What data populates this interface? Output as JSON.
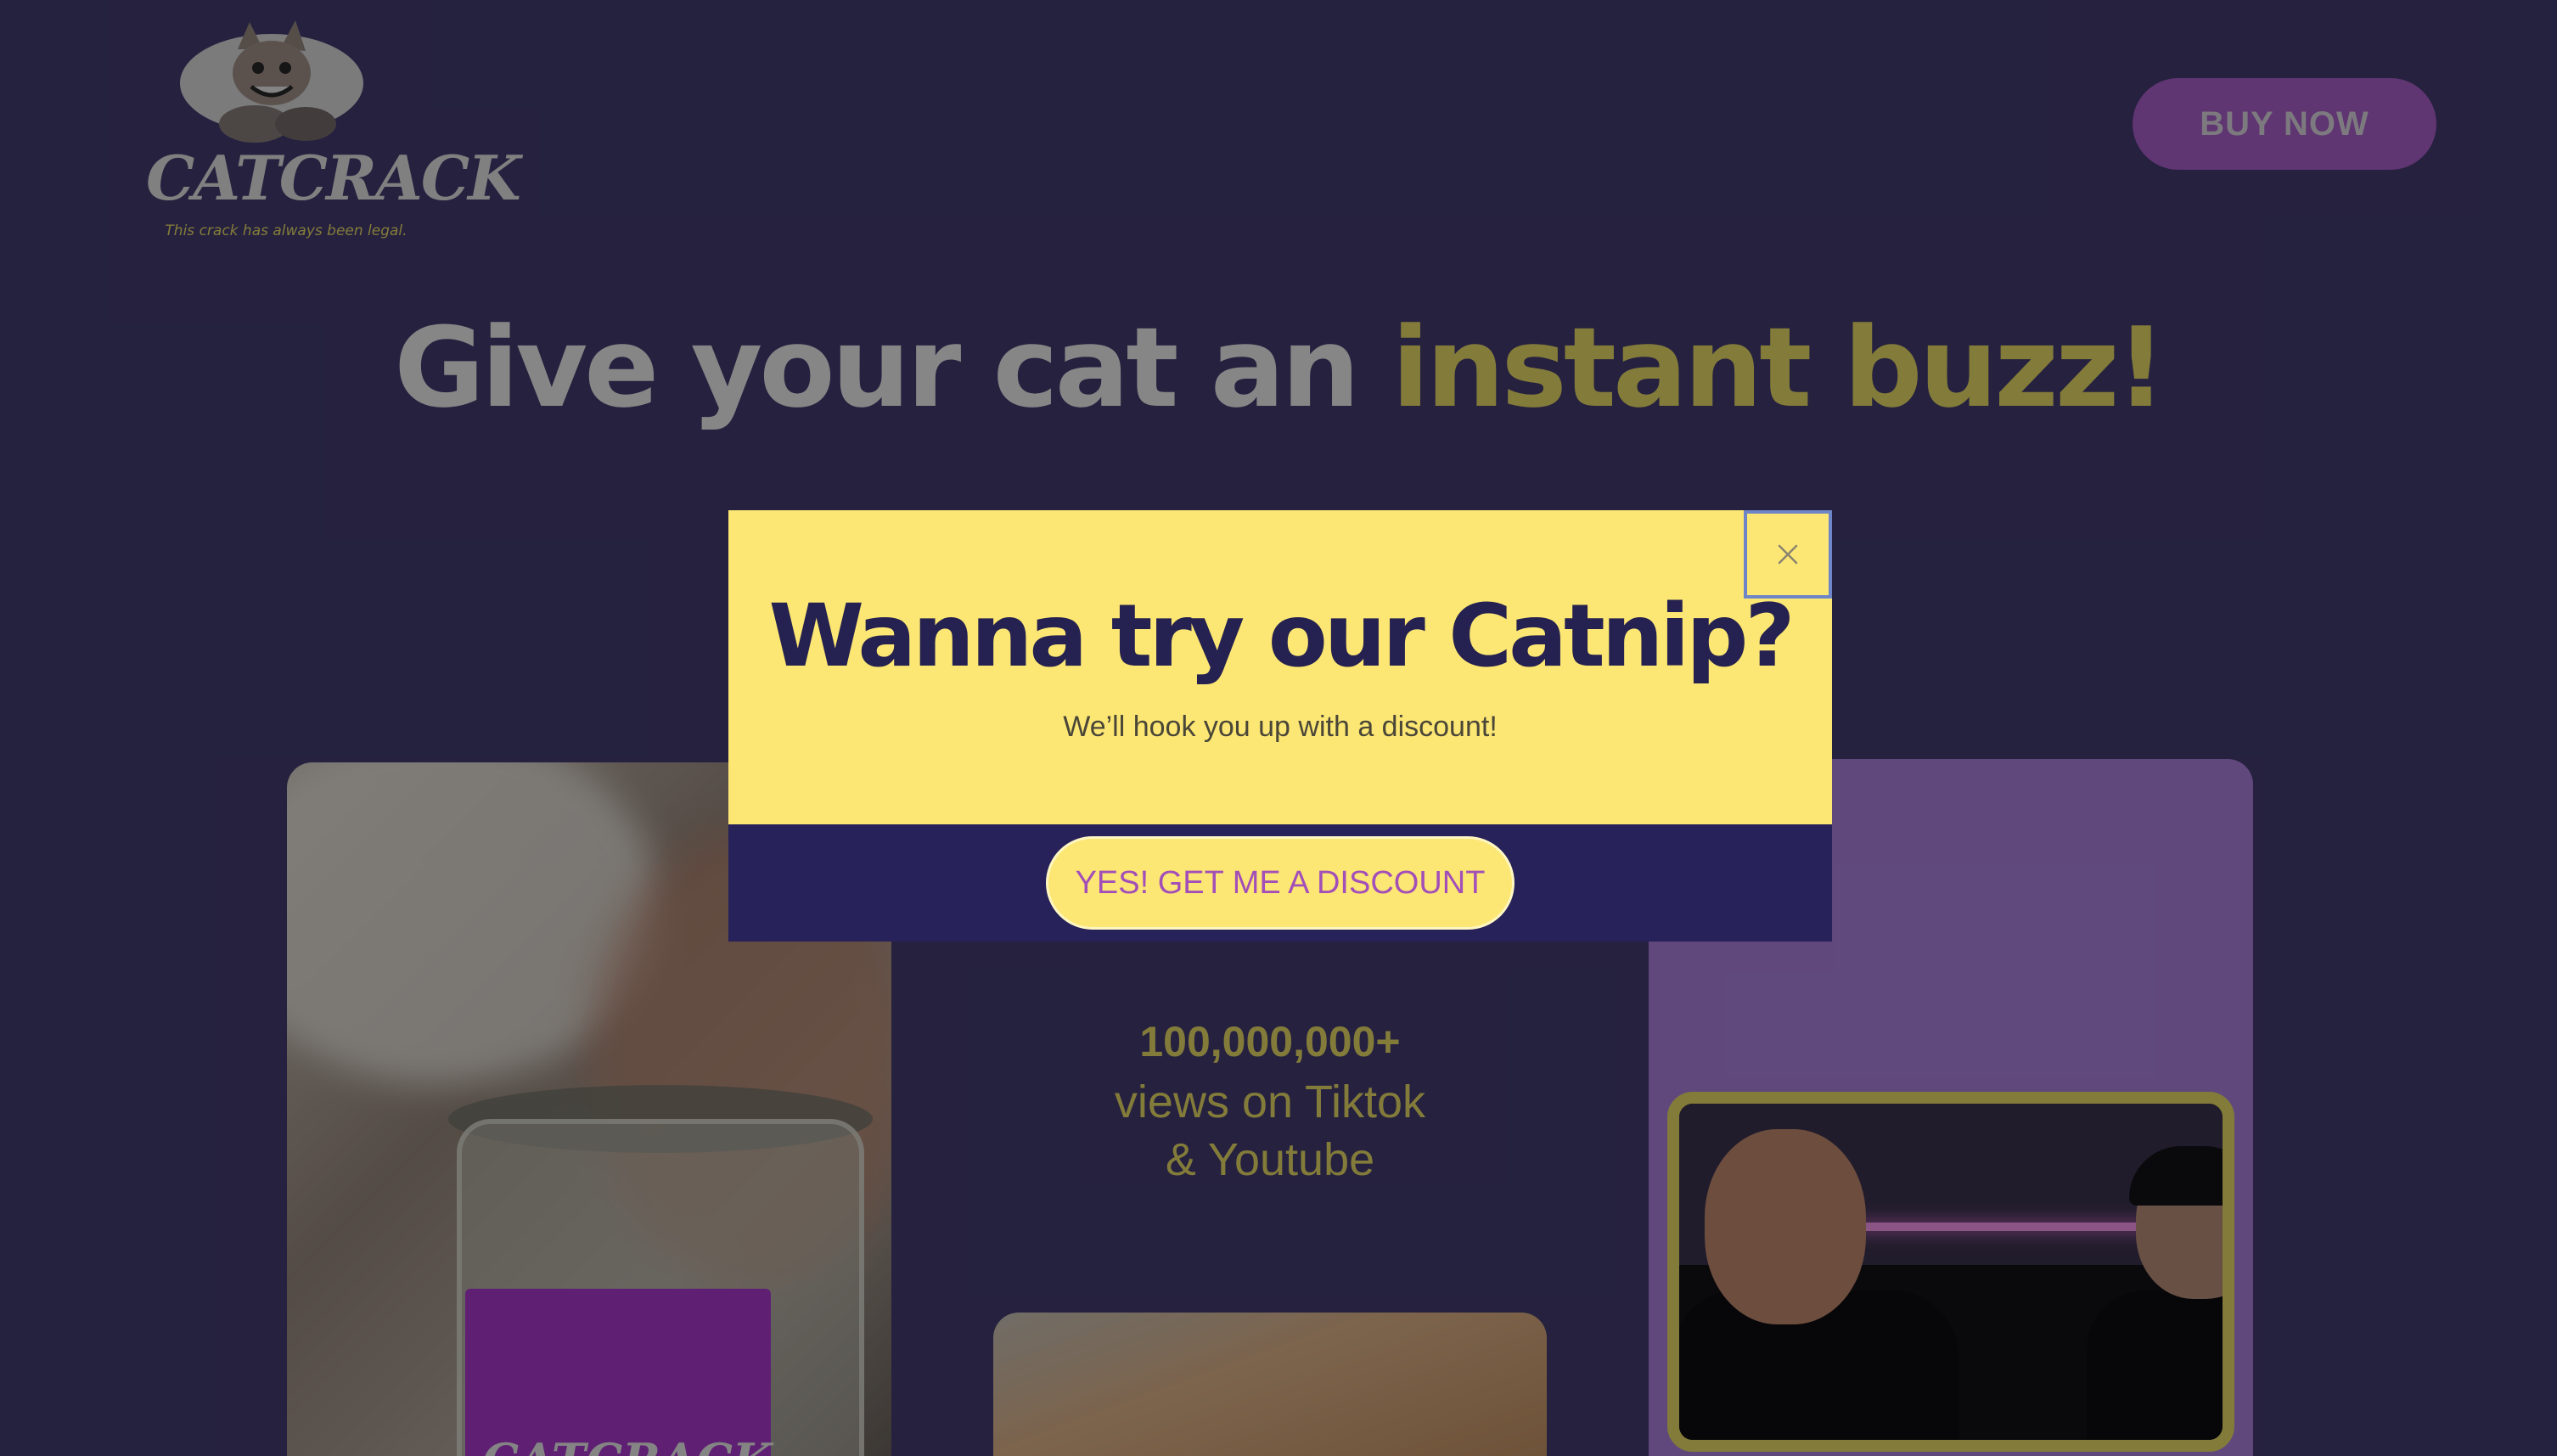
{
  "header": {
    "logo_text": "CATCRACK",
    "logo_tagline": "This crack has always been legal.",
    "buy_now_label": "BUY NOW"
  },
  "hero": {
    "title_plain": "Give your cat an ",
    "title_accent": "instant buzz!"
  },
  "stats": {
    "number": "100,000,000+",
    "line1": "views on Tiktok",
    "line2": "& Youtube"
  },
  "product": {
    "jar_label": "CATCRACK"
  },
  "modal": {
    "title": "Wanna try our Catnip?",
    "subtitle": "We’ll hook you up with a discount!",
    "cta_label": "YES! GET ME A DISCOUNT",
    "close_icon": "close-icon"
  },
  "colors": {
    "page_background": "#453e75",
    "accent_yellow": "#f2e46b",
    "modal_yellow": "#fce774",
    "modal_navy": "#27225a",
    "cta_text": "#a34fb8",
    "buy_now_bg": "#b062d2",
    "card_purple": "#b286e6"
  }
}
